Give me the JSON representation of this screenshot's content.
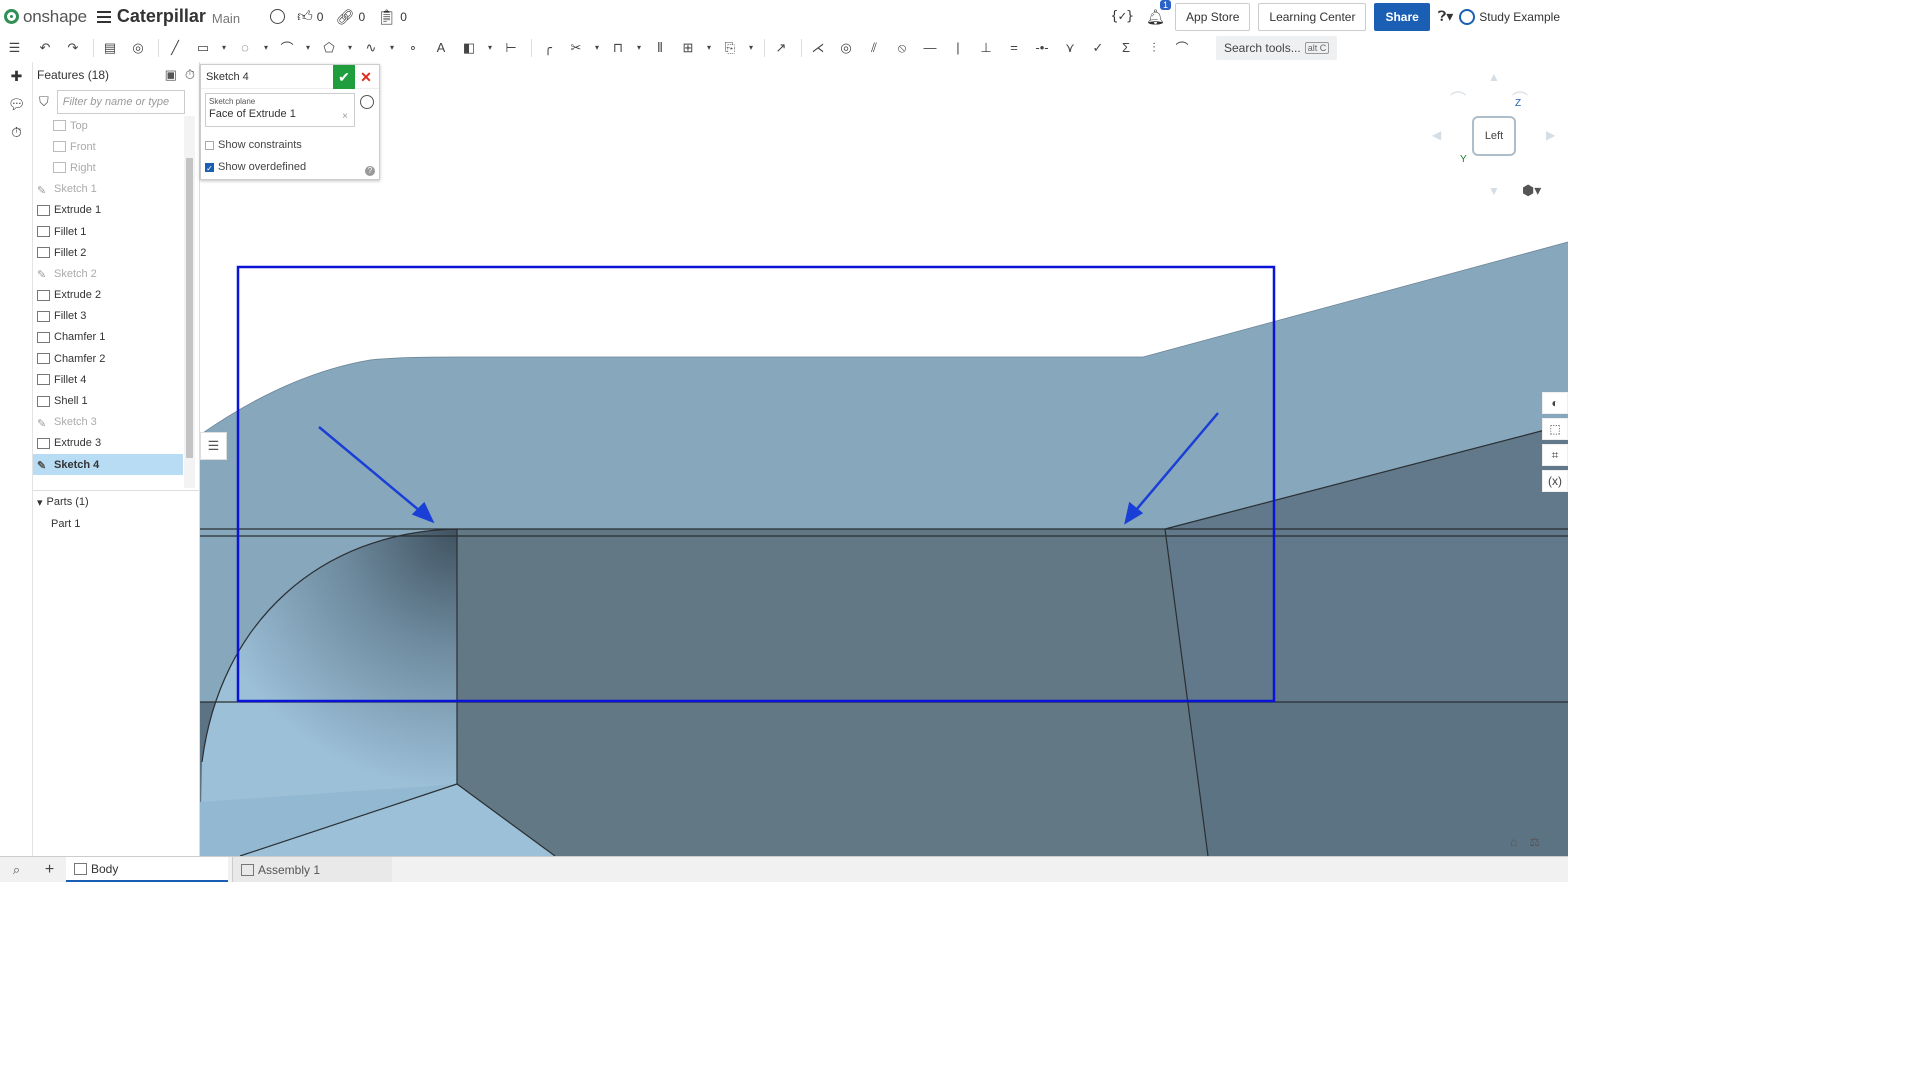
{
  "app": {
    "logo_text": "onshape",
    "doc_title": "Caterpillar",
    "branch": "Main",
    "likes": "0",
    "links": "0",
    "copies": "0"
  },
  "header": {
    "notifications": "1",
    "app_store": "App Store",
    "learning_center": "Learning Center",
    "share": "Share",
    "user": "Study Example"
  },
  "toolbar": {
    "search_tools": "Search tools...",
    "shortcut": "alt C"
  },
  "features": {
    "title": "Features (18)",
    "filter_placeholder": "Filter by name or type",
    "items": [
      {
        "label": "Top",
        "type": "plane",
        "muted": true
      },
      {
        "label": "Front",
        "type": "plane",
        "muted": true
      },
      {
        "label": "Right",
        "type": "plane",
        "muted": true
      },
      {
        "label": "Sketch 1",
        "type": "sketch",
        "muted": true
      },
      {
        "label": "Extrude 1",
        "type": "extrude",
        "muted": false
      },
      {
        "label": "Fillet 1",
        "type": "fillet",
        "muted": false
      },
      {
        "label": "Fillet 2",
        "type": "fillet",
        "muted": false
      },
      {
        "label": "Sketch 2",
        "type": "sketch",
        "muted": true
      },
      {
        "label": "Extrude 2",
        "type": "extrude",
        "muted": false
      },
      {
        "label": "Fillet 3",
        "type": "fillet",
        "muted": false
      },
      {
        "label": "Chamfer 1",
        "type": "fillet",
        "muted": false
      },
      {
        "label": "Chamfer 2",
        "type": "fillet",
        "muted": false
      },
      {
        "label": "Fillet 4",
        "type": "fillet",
        "muted": false
      },
      {
        "label": "Shell 1",
        "type": "extrude",
        "muted": false
      },
      {
        "label": "Sketch 3",
        "type": "sketch",
        "muted": true
      },
      {
        "label": "Extrude 3",
        "type": "extrude",
        "muted": false
      },
      {
        "label": "Sketch 4",
        "type": "sketch",
        "muted": false,
        "selected": true
      }
    ],
    "parts_header": "Parts (1)",
    "parts": [
      "Part 1"
    ]
  },
  "sketch_dialog": {
    "title": "Sketch 4",
    "plane_label": "Sketch plane",
    "plane_value": "Face of Extrude 1",
    "show_constraints": "Show constraints",
    "show_constraints_checked": false,
    "show_overdefined": "Show overdefined",
    "show_overdefined_checked": true
  },
  "view_cube": {
    "face": "Left",
    "axis_z": "Z",
    "axis_y": "Y"
  },
  "tabs": [
    {
      "label": "Body",
      "active": true
    },
    {
      "label": "Assembly 1",
      "active": false
    }
  ],
  "colors": {
    "accent": "#1a5fb4",
    "ok": "#1e9e3c",
    "cancel": "#e0281c",
    "annotation": "#0a14d6",
    "part_light": "#8aa6ba",
    "part_dark": "#627885",
    "selection": "#b9dcf5"
  }
}
